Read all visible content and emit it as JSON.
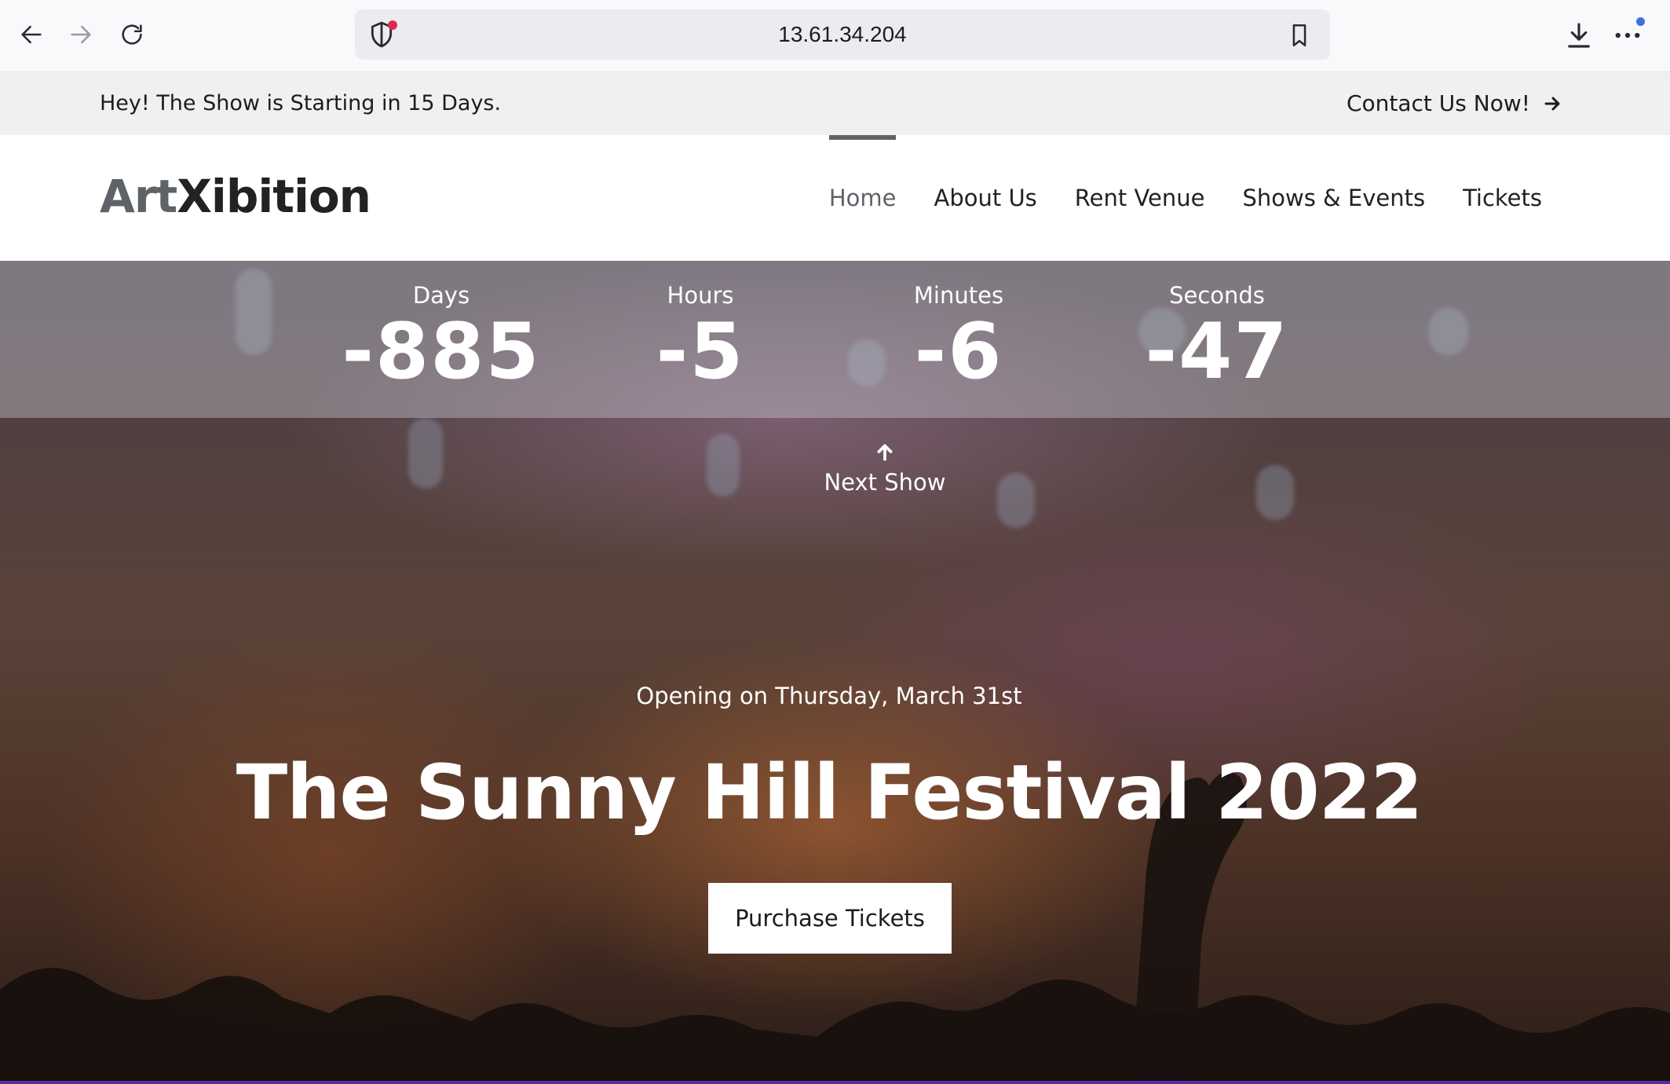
{
  "browser": {
    "url": "13.61.34.204"
  },
  "announcement": {
    "message": "Hey! The Show is Starting in 15 Days.",
    "contact_label": "Contact Us Now!"
  },
  "header": {
    "logo_part1": "Art",
    "logo_part2": "Xibition",
    "menu": [
      {
        "label": "Home",
        "active": true
      },
      {
        "label": "About Us"
      },
      {
        "label": "Rent Venue"
      },
      {
        "label": "Shows & Events"
      },
      {
        "label": "Tickets"
      }
    ]
  },
  "countdown": {
    "days_label": "Days",
    "days_value": "-885",
    "hours_label": "Hours",
    "hours_value": "-5",
    "minutes_label": "Minutes",
    "minutes_value": "-6",
    "seconds_label": "Seconds",
    "seconds_value": "-47"
  },
  "hero": {
    "next_show_label": "Next Show",
    "opening_text": "Opening on Thursday, March 31st",
    "title": "The Sunny Hill Festival 2022",
    "purchase_label": "Purchase Tickets"
  }
}
